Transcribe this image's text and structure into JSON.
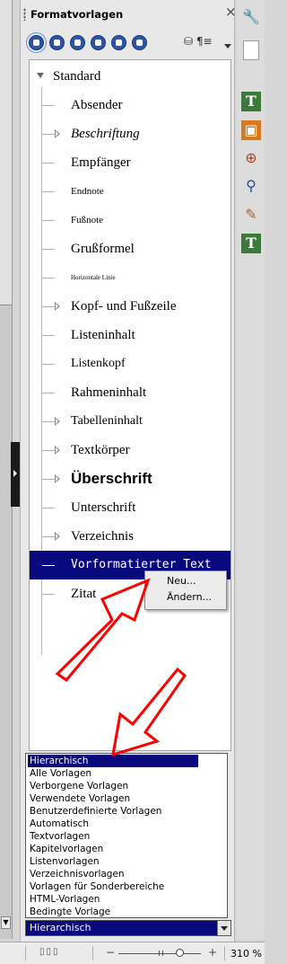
{
  "panel": {
    "title": "Formatvorlagen",
    "close_icon": "×",
    "styles_menu_icon": "¶≡"
  },
  "style_tree": {
    "root": "Standard",
    "items": [
      {
        "label": "Absender",
        "expandable": false
      },
      {
        "label": "Beschriftung",
        "expandable": true
      },
      {
        "label": "Empfänger",
        "expandable": false
      },
      {
        "label": "Endnote",
        "expandable": false
      },
      {
        "label": "Fußnote",
        "expandable": false
      },
      {
        "label": "Grußformel",
        "expandable": false
      },
      {
        "label": "Horizontale Linie",
        "expandable": false
      },
      {
        "label": "Kopf- und Fußzeile",
        "expandable": true
      },
      {
        "label": "Listeninhalt",
        "expandable": false
      },
      {
        "label": "Listenkopf",
        "expandable": false
      },
      {
        "label": "Rahmeninhalt",
        "expandable": false
      },
      {
        "label": "Tabelleninhalt",
        "expandable": true
      },
      {
        "label": "Textkörper",
        "expandable": true
      },
      {
        "label": "Überschrift",
        "expandable": true
      },
      {
        "label": "Unterschrift",
        "expandable": false
      },
      {
        "label": "Verzeichnis",
        "expandable": true
      },
      {
        "label": "Vorformatierter Text",
        "expandable": false,
        "selected": true
      },
      {
        "label": "Zitat",
        "expandable": false
      }
    ]
  },
  "context_menu": {
    "items": [
      "Neu...",
      "Ändern..."
    ]
  },
  "filter_dropdown": {
    "selected": "Hierarchisch",
    "options": [
      "Hierarchisch",
      "Alle Vorlagen",
      "Verborgene Vorlagen",
      "Verwendete Vorlagen",
      "Benutzerdefinierte Vorlagen",
      "Automatisch",
      "Textvorlagen",
      "Kapitelvorlagen",
      "Listenvorlagen",
      "Verzeichnisvorlagen",
      "Vorlagen für Sonderbereiche",
      "HTML-Vorlagen",
      "Bedingte Vorlage"
    ]
  },
  "sidebar_tabs": [
    "wrench-icon",
    "page-icon",
    "styles-icon",
    "gallery-icon",
    "navigator-icon",
    "inspector-icon",
    "manage-changes-icon",
    "design-icon"
  ],
  "statusbar": {
    "zoom": "310 %"
  },
  "colors": {
    "selection": "#09097e",
    "annotation_arrow": "#ff0000"
  }
}
